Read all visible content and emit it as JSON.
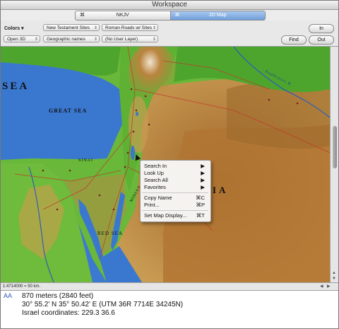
{
  "window": {
    "title": "Workspace"
  },
  "tabs": [
    {
      "label": "NKJV",
      "icon": "gear-icon"
    },
    {
      "label": "2D Map",
      "icon": "gear-icon"
    }
  ],
  "toolbar": {
    "colors_label": "Colors",
    "open3d_label": "Open 3D",
    "site_layer": "New Testament Sites",
    "road_layer": "Roman Roads w/ Sites",
    "names_layer": "Geographic names",
    "user_layer": "(No User Layer)",
    "in_label": "In",
    "find_label": "Find",
    "out_label": "Out"
  },
  "map_labels": {
    "sea_partial": "SEA",
    "great_sea": "GREAT SEA",
    "sinai": "SINAI",
    "red_sea": "RED SEA",
    "midian": "MIDIAN",
    "arabia_partial": "IA",
    "euphrates": "Euphrates R."
  },
  "context_menu": {
    "items": [
      {
        "label": "Search In",
        "shortcut": "",
        "submenu": true
      },
      {
        "label": "Look Up",
        "shortcut": "",
        "submenu": true
      },
      {
        "label": "Search All",
        "shortcut": "",
        "submenu": true
      },
      {
        "label": "Favorites",
        "shortcut": "",
        "submenu": true
      },
      {
        "label": "Copy Name",
        "shortcut": "⌘C",
        "submenu": false
      },
      {
        "label": "Print...",
        "shortcut": "⌘P",
        "submenu": false
      },
      {
        "label": "Set Map Display...",
        "shortcut": "⌘T",
        "submenu": false
      }
    ]
  },
  "scale": {
    "text": "1:4714000 = 50 km."
  },
  "info": {
    "elevation": "870 meters (2840 feet)",
    "coordinates": "30° 55.2' N  35° 50.42' E (UTM 36R 7714E 34245N)",
    "israel": "Israel coordinates: 229.3 36.6"
  }
}
